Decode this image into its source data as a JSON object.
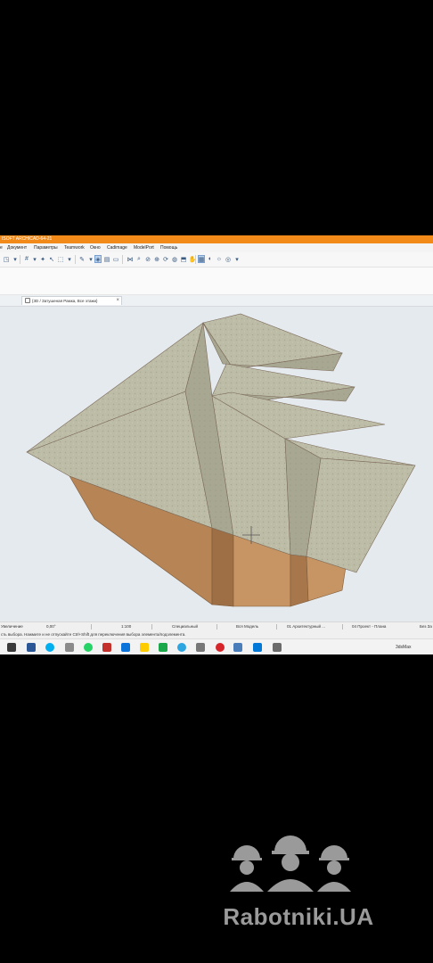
{
  "app": {
    "title": "ISOFT ARCHICAD-64-21",
    "accent": "#f28a1a"
  },
  "menu": {
    "items": [
      "е",
      "Документ",
      "Параметры",
      "Teamwork",
      "Окно",
      "Cadimage",
      "ModelPort",
      "Помощь"
    ]
  },
  "toolbar": {
    "icons": [
      "selection-icon",
      "magic-wand-icon",
      "grid-icon",
      "dropdown-icon",
      "cursor-icon",
      "pen-icon",
      "marquee-icon",
      "layer-icon",
      "find-icon",
      "3d-view-icon",
      "elevation-icon",
      "section-icon",
      "hide-icon",
      "zoom-icon",
      "orbit-icon",
      "walk-icon",
      "grid-snap-icon",
      "render-icon",
      "sun-icon",
      "camera-icon"
    ]
  },
  "tab": {
    "label": "{3D / Затушеная Рамка, Все этажи}",
    "close": "×"
  },
  "status": {
    "zoom_mode": "Увеличение",
    "zoom_value": "0,00°",
    "scale": "1:100",
    "override": "Специальный",
    "model_view": "Вся Модель",
    "layer_combo": "01 Архитектурный ...",
    "view_set": "04 Проект - Плана",
    "extra": "Без За"
  },
  "hint": {
    "text": "сть выбора. Нажмите и не отпускайте Ctrl+Shift для переключения выбора элемента/подэлемента."
  },
  "taskbar": {
    "tray_label": "3dsMax"
  },
  "watermark": {
    "text": "Rabotniki.UA"
  },
  "colors": {
    "roof": "#b8b8a2",
    "wall": "#c79463",
    "viewport_bg": "#e5eaee"
  }
}
